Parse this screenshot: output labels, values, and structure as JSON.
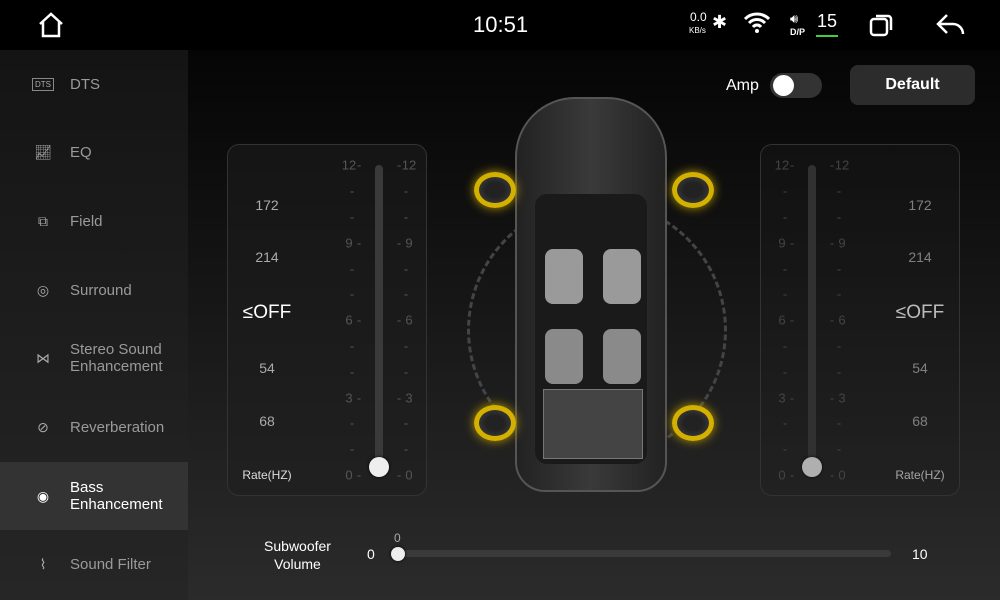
{
  "status": {
    "time": "10:51",
    "net_speed": "0.0",
    "net_unit": "KB/s",
    "volume_mode": "D/P",
    "volume": "15",
    "accent": "#3fcf3f"
  },
  "sidebar": {
    "items": [
      {
        "label": "DTS",
        "icon": "DTS"
      },
      {
        "label": "EQ",
        "icon": "eq-icon"
      },
      {
        "label": "Field",
        "icon": "field-icon"
      },
      {
        "label": "Surround",
        "icon": "surround-icon"
      },
      {
        "label": "Stereo Sound Enhancement",
        "icon": "stereo-icon"
      },
      {
        "label": "Reverberation",
        "icon": "reverb-icon"
      },
      {
        "label": "Bass Enhancement",
        "icon": "bass-icon",
        "selected": true
      },
      {
        "label": "Sound Filter",
        "icon": "filter-icon"
      }
    ]
  },
  "controls": {
    "amp_label": "Amp",
    "amp_on": false,
    "default_label": "Default"
  },
  "left_panel": {
    "rates": [
      "172",
      "214",
      "≤OFF",
      "54",
      "68"
    ],
    "rate_label": "Rate(HZ)",
    "scale": [
      "12",
      "9",
      "6",
      "3",
      "0"
    ],
    "value": 0
  },
  "right_panel": {
    "rates": [
      "172",
      "214",
      "≤OFF",
      "54",
      "68"
    ],
    "rate_label": "Rate(HZ)",
    "scale": [
      "12",
      "9",
      "6",
      "3",
      "0"
    ],
    "value": 0
  },
  "subwoofer": {
    "label": "Subwoofer Volume",
    "min": "0",
    "max": "10",
    "value": "0"
  },
  "speaker_color": "#d4b000"
}
